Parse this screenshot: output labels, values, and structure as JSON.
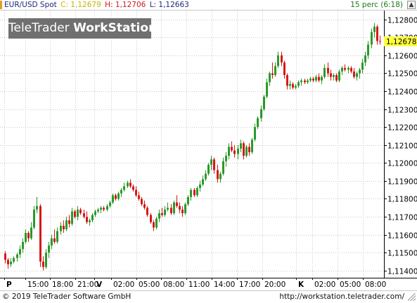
{
  "header": {
    "symbol": "EUR/USD Spot",
    "close_label": "C: 1,12679",
    "high_label": "H: 1,12706",
    "low_label": "L: 1,12663",
    "period_label": "15 perc (6:18)",
    "collapse_icon": "caret-up-icon"
  },
  "logo": {
    "part1": "TeleTrader ",
    "part2": "WorkStation"
  },
  "footer": {
    "copyright": "© 2019 TeleTrader Software GmbH",
    "url": "http://workstation.teletrader.com/"
  },
  "colors": {
    "up": "#2a9a2a",
    "down": "#d81818",
    "grid": "#c8c8c8",
    "last_price_bg": "#ffff40",
    "accent_yellow": "#c8b400",
    "period_green": "#1a7a1a"
  },
  "chart_data": {
    "type": "candlestick",
    "title": "EUR/USD Spot",
    "interval": "15 perc",
    "ylim": [
      1.1136,
      1.1285
    ],
    "y_ticks": [
      "1,11400",
      "1,11500",
      "1,11600",
      "1,11700",
      "1,11800",
      "1,11900",
      "1,12000",
      "1,12100",
      "1,12200",
      "1,12300",
      "1,12400",
      "1,12500",
      "1,12600",
      "1,12700",
      "1,12800"
    ],
    "y_tick_values": [
      1.114,
      1.115,
      1.116,
      1.117,
      1.118,
      1.119,
      1.12,
      1.121,
      1.122,
      1.123,
      1.124,
      1.125,
      1.126,
      1.127,
      1.128
    ],
    "last_price_label": "1,12678",
    "last_price": 1.12678,
    "x_ticks": [
      {
        "label": "P",
        "bold": true,
        "pos": 0.0
      },
      {
        "label": "15:00",
        "bold": false,
        "pos": 0.056
      },
      {
        "label": "18:00",
        "bold": false,
        "pos": 0.124
      },
      {
        "label": "21:00",
        "bold": false,
        "pos": 0.192
      },
      {
        "label": "V",
        "bold": true,
        "pos": 0.243
      },
      {
        "label": "02:00",
        "bold": false,
        "pos": 0.288
      },
      {
        "label": "05:00",
        "bold": false,
        "pos": 0.356
      },
      {
        "label": "08:00",
        "bold": false,
        "pos": 0.424
      },
      {
        "label": "11:00",
        "bold": false,
        "pos": 0.492
      },
      {
        "label": "14:00",
        "bold": false,
        "pos": 0.56
      },
      {
        "label": "17:00",
        "bold": false,
        "pos": 0.628
      },
      {
        "label": "20:00",
        "bold": false,
        "pos": 0.696
      },
      {
        "label": "K",
        "bold": true,
        "pos": 0.787
      },
      {
        "label": "02:00",
        "bold": false,
        "pos": 0.832
      },
      {
        "label": "05:00",
        "bold": false,
        "pos": 0.9
      },
      {
        "label": "08:00",
        "bold": false,
        "pos": 0.968
      }
    ],
    "series": [
      {
        "kind": "ohlc",
        "values": [
          [
            1.11495,
            1.11508,
            1.1144,
            1.1146
          ],
          [
            1.1146,
            1.1147,
            1.1141,
            1.11435
          ],
          [
            1.11435,
            1.1147,
            1.1142,
            1.1145
          ],
          [
            1.1145,
            1.1148,
            1.1144,
            1.1147
          ],
          [
            1.1147,
            1.115,
            1.1145,
            1.1149
          ],
          [
            1.1149,
            1.1154,
            1.1147,
            1.1152
          ],
          [
            1.1152,
            1.1158,
            1.115,
            1.1156
          ],
          [
            1.1156,
            1.1163,
            1.1155,
            1.1161
          ],
          [
            1.1161,
            1.1162,
            1.1156,
            1.1158
          ],
          [
            1.1158,
            1.1167,
            1.1157,
            1.1164
          ],
          [
            1.1164,
            1.1176,
            1.1163,
            1.1174
          ],
          [
            1.1174,
            1.1181,
            1.1172,
            1.1176
          ],
          [
            1.1176,
            1.1177,
            1.1142,
            1.1145
          ],
          [
            1.1145,
            1.1148,
            1.114,
            1.1142
          ],
          [
            1.1142,
            1.1152,
            1.1141,
            1.115
          ],
          [
            1.115,
            1.1156,
            1.1147,
            1.1154
          ],
          [
            1.1154,
            1.116,
            1.1152,
            1.1158
          ],
          [
            1.1158,
            1.1163,
            1.1155,
            1.1156
          ],
          [
            1.1156,
            1.1164,
            1.1155,
            1.1162
          ],
          [
            1.1162,
            1.1167,
            1.116,
            1.1165
          ],
          [
            1.1165,
            1.1168,
            1.1161,
            1.1163
          ],
          [
            1.1163,
            1.117,
            1.1162,
            1.1168
          ],
          [
            1.1168,
            1.1171,
            1.1164,
            1.1166
          ],
          [
            1.1166,
            1.1175,
            1.1165,
            1.1173
          ],
          [
            1.1173,
            1.1174,
            1.1169,
            1.117
          ],
          [
            1.117,
            1.1176,
            1.1168,
            1.1174
          ],
          [
            1.1174,
            1.1175,
            1.1171,
            1.1172
          ],
          [
            1.1172,
            1.1174,
            1.1169,
            1.117
          ],
          [
            1.117,
            1.1173,
            1.1166,
            1.1167
          ],
          [
            1.1167,
            1.1169,
            1.1165,
            1.1168
          ],
          [
            1.1168,
            1.1172,
            1.1167,
            1.1171
          ],
          [
            1.1171,
            1.1174,
            1.117,
            1.1173
          ],
          [
            1.1173,
            1.1175,
            1.1172,
            1.1174
          ],
          [
            1.1174,
            1.1176,
            1.1172,
            1.1175
          ],
          [
            1.1175,
            1.1176,
            1.1173,
            1.1174
          ],
          [
            1.1174,
            1.1177,
            1.1173,
            1.1176
          ],
          [
            1.1176,
            1.1179,
            1.1175,
            1.1178
          ],
          [
            1.1178,
            1.1183,
            1.1177,
            1.1182
          ],
          [
            1.1182,
            1.1183,
            1.1179,
            1.118
          ],
          [
            1.118,
            1.1184,
            1.1179,
            1.1183
          ],
          [
            1.1183,
            1.1186,
            1.1181,
            1.1185
          ],
          [
            1.1185,
            1.1189,
            1.1184,
            1.1187
          ],
          [
            1.1187,
            1.119,
            1.1186,
            1.1189
          ],
          [
            1.1189,
            1.1191,
            1.1186,
            1.1187
          ],
          [
            1.1187,
            1.1188,
            1.1184,
            1.1185
          ],
          [
            1.1185,
            1.1187,
            1.1181,
            1.1182
          ],
          [
            1.1182,
            1.1184,
            1.1179,
            1.118
          ],
          [
            1.118,
            1.1181,
            1.1176,
            1.1177
          ],
          [
            1.1177,
            1.1179,
            1.1174,
            1.1175
          ],
          [
            1.1175,
            1.1176,
            1.117,
            1.1171
          ],
          [
            1.1171,
            1.1172,
            1.1166,
            1.1167
          ],
          [
            1.1167,
            1.1168,
            1.1162,
            1.1164
          ],
          [
            1.1164,
            1.117,
            1.1163,
            1.1169
          ],
          [
            1.1169,
            1.1174,
            1.1167,
            1.1172
          ],
          [
            1.1172,
            1.1175,
            1.117,
            1.1171
          ],
          [
            1.1171,
            1.1176,
            1.117,
            1.1174
          ],
          [
            1.1174,
            1.1178,
            1.1173,
            1.1175
          ],
          [
            1.1175,
            1.1177,
            1.1171,
            1.1172
          ],
          [
            1.1172,
            1.1179,
            1.1171,
            1.1178
          ],
          [
            1.1178,
            1.1182,
            1.1175,
            1.1176
          ],
          [
            1.1176,
            1.1178,
            1.1172,
            1.1174
          ],
          [
            1.1174,
            1.1176,
            1.117,
            1.1172
          ],
          [
            1.1172,
            1.1178,
            1.1171,
            1.1177
          ],
          [
            1.1177,
            1.1182,
            1.1176,
            1.1181
          ],
          [
            1.1181,
            1.1186,
            1.1179,
            1.1185
          ],
          [
            1.1185,
            1.1186,
            1.1181,
            1.1182
          ],
          [
            1.1182,
            1.1187,
            1.1181,
            1.1186
          ],
          [
            1.1186,
            1.119,
            1.1184,
            1.1188
          ],
          [
            1.1188,
            1.1193,
            1.1187,
            1.1191
          ],
          [
            1.1191,
            1.1196,
            1.119,
            1.1194
          ],
          [
            1.1194,
            1.12,
            1.1193,
            1.1199
          ],
          [
            1.1199,
            1.1204,
            1.1196,
            1.1202
          ],
          [
            1.1202,
            1.1203,
            1.1194,
            1.1196
          ],
          [
            1.1196,
            1.1199,
            1.1189,
            1.1191
          ],
          [
            1.1191,
            1.1195,
            1.1189,
            1.1194
          ],
          [
            1.1194,
            1.1203,
            1.1193,
            1.1201
          ],
          [
            1.1201,
            1.1206,
            1.1198,
            1.1204
          ],
          [
            1.1204,
            1.1211,
            1.1202,
            1.1209
          ],
          [
            1.1209,
            1.1212,
            1.1206,
            1.1207
          ],
          [
            1.1207,
            1.121,
            1.1203,
            1.1205
          ],
          [
            1.1205,
            1.121,
            1.1202,
            1.1208
          ],
          [
            1.1208,
            1.1213,
            1.1206,
            1.1211
          ],
          [
            1.1211,
            1.1212,
            1.1202,
            1.1204
          ],
          [
            1.1204,
            1.121,
            1.1203,
            1.1209
          ],
          [
            1.1209,
            1.1211,
            1.1204,
            1.1206
          ],
          [
            1.1206,
            1.1214,
            1.1205,
            1.1213
          ],
          [
            1.1213,
            1.1222,
            1.1212,
            1.122
          ],
          [
            1.122,
            1.1226,
            1.1219,
            1.1225
          ],
          [
            1.1225,
            1.1232,
            1.1223,
            1.123
          ],
          [
            1.123,
            1.1238,
            1.1229,
            1.1237
          ],
          [
            1.1237,
            1.1247,
            1.1236,
            1.1245
          ],
          [
            1.1245,
            1.1251,
            1.1243,
            1.125
          ],
          [
            1.125,
            1.1256,
            1.1247,
            1.1249
          ],
          [
            1.1249,
            1.1256,
            1.1248,
            1.1254
          ],
          [
            1.1254,
            1.1262,
            1.1253,
            1.126
          ],
          [
            1.126,
            1.1262,
            1.1254,
            1.1256
          ],
          [
            1.1256,
            1.1257,
            1.1247,
            1.1249
          ],
          [
            1.1249,
            1.125,
            1.1241,
            1.1243
          ],
          [
            1.1243,
            1.1246,
            1.1241,
            1.1244
          ],
          [
            1.1244,
            1.1245,
            1.1241,
            1.1242
          ],
          [
            1.1242,
            1.1244,
            1.1241,
            1.1243
          ],
          [
            1.1243,
            1.1246,
            1.1242,
            1.1245
          ],
          [
            1.1245,
            1.1247,
            1.1243,
            1.1246
          ],
          [
            1.1246,
            1.1247,
            1.1244,
            1.1245
          ],
          [
            1.1245,
            1.1247,
            1.1244,
            1.1246
          ],
          [
            1.1246,
            1.1248,
            1.1245,
            1.1247
          ],
          [
            1.1247,
            1.1248,
            1.1245,
            1.1246
          ],
          [
            1.1246,
            1.1249,
            1.1245,
            1.1248
          ],
          [
            1.1248,
            1.125,
            1.1245,
            1.1246
          ],
          [
            1.1246,
            1.1249,
            1.1244,
            1.1248
          ],
          [
            1.1248,
            1.1255,
            1.1247,
            1.1253
          ],
          [
            1.1253,
            1.1256,
            1.1248,
            1.125
          ],
          [
            1.125,
            1.1252,
            1.1246,
            1.1248
          ],
          [
            1.1248,
            1.125,
            1.1246,
            1.1249
          ],
          [
            1.1249,
            1.125,
            1.1245,
            1.1246
          ],
          [
            1.1246,
            1.1252,
            1.1245,
            1.1251
          ],
          [
            1.1251,
            1.1254,
            1.1249,
            1.1253
          ],
          [
            1.1253,
            1.1255,
            1.1251,
            1.1252
          ],
          [
            1.1252,
            1.1254,
            1.125,
            1.1253
          ],
          [
            1.1253,
            1.1254,
            1.125,
            1.1251
          ],
          [
            1.1251,
            1.1253,
            1.1247,
            1.1248
          ],
          [
            1.1248,
            1.1251,
            1.1246,
            1.125
          ],
          [
            1.125,
            1.1253,
            1.1247,
            1.1252
          ],
          [
            1.1252,
            1.1258,
            1.125,
            1.1256
          ],
          [
            1.1256,
            1.1262,
            1.1254,
            1.126
          ],
          [
            1.126,
            1.1268,
            1.1258,
            1.1266
          ],
          [
            1.1266,
            1.1275,
            1.1264,
            1.1273
          ],
          [
            1.1273,
            1.1278,
            1.127,
            1.1276
          ],
          [
            1.1276,
            1.1277,
            1.1266,
            1.1268
          ],
          [
            1.1268,
            1.1271,
            1.1266,
            1.12679
          ]
        ]
      }
    ]
  }
}
